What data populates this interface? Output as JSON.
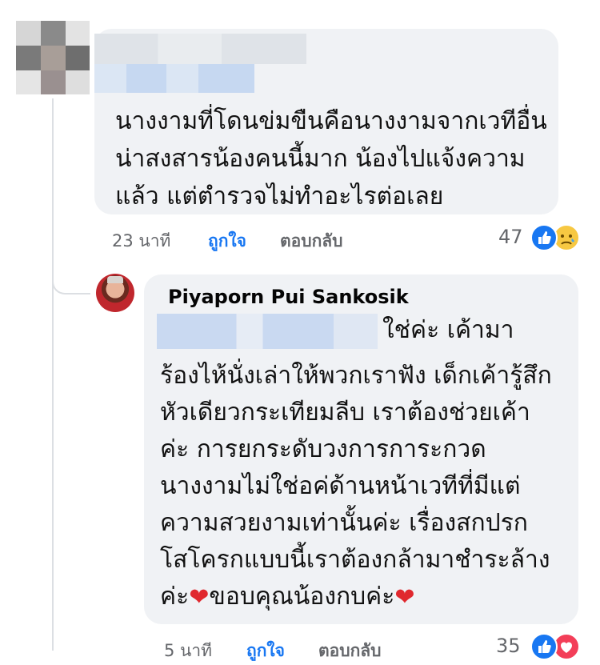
{
  "comments": [
    {
      "author_name": "",
      "text_lines": [
        "นางงามที่โดนข่มขืนคือนางงามจากเวทีอื่น",
        "น่าสงสารน้องคนนี้มาก น้องไปแจ้งความ",
        "แล้ว แต่ตำรวจไม่ทำอะไรต่อเลย"
      ],
      "time": "23 นาที",
      "like_label": "ถูกใจ",
      "reply_label": "ตอบกลับ",
      "reaction_count": "47",
      "reactions": [
        "like-icon",
        "sad-icon"
      ]
    },
    {
      "author_name": "Piyaporn Pui Sankosik",
      "text_lines": [
        "ใช่ค่ะ เค้ามา",
        "ร้องไห้นั่งเล่าให้พวกเราฟัง เด็กเค้ารู้สึก",
        "หัวเดียวกระเทียมลีบ เราต้องช่วยเค้า",
        "ค่ะ การยกระดับวงการการะกวด",
        "นางงามไม่ใช่อค่ด้านหน้าเวทีที่มีแต่",
        "ความสวยงามเท่านั้นค่ะ เรื่องสกปรก",
        "โสโครกแบบนี้เราต้องกล้ามาชำระล้าง"
      ],
      "last_line_prefix": "ค่ะ",
      "last_line_middle": "ขอบคุณน้องกบค่ะ",
      "time": "5 นาที",
      "like_label": "ถูกใจ",
      "reply_label": "ตอบกลับ",
      "reaction_count": "35",
      "reactions": [
        "like-icon",
        "love-icon"
      ]
    }
  ],
  "colors": {
    "bubble": "#f0f2f5",
    "like_blue": "#1877f2",
    "meta_gray": "#65676b",
    "heart_red": "#e0282e"
  }
}
